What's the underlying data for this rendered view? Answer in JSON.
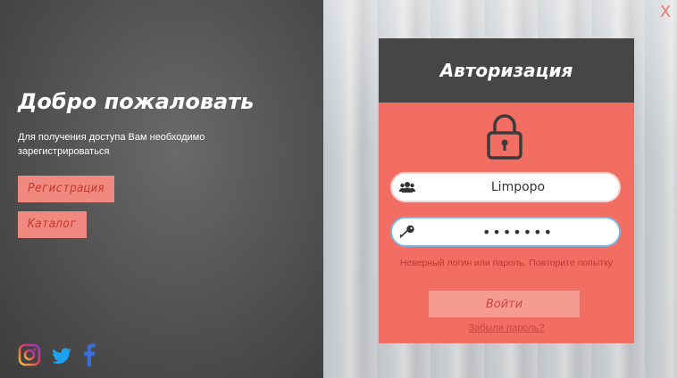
{
  "left": {
    "title": "Добро пожаловать",
    "subtitle": "Для получения доступа Вам необходимо зарегистрироваться",
    "register_label": "Регистрация",
    "catalog_label": "Каталог",
    "social_icons": [
      "instagram-icon",
      "twitter-icon",
      "facebook-icon"
    ]
  },
  "window": {
    "close_label": "X"
  },
  "auth": {
    "title": "Авторизация",
    "login_value": "Limpopo",
    "password_value": "•••••••",
    "error": "Неверный логин или пароль. Повторите попытку",
    "login_button": "Войти",
    "forgot_link": "Забыли пароль?"
  },
  "colors": {
    "card": "#f36e62",
    "header": "#464646",
    "left_button": "#f08a80",
    "focus_border": "#78b8e8"
  }
}
